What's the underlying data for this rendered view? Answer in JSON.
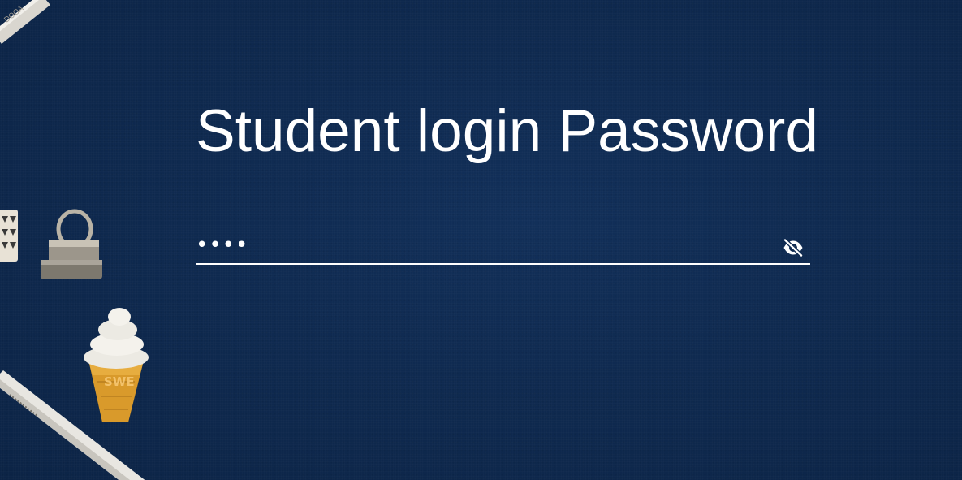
{
  "page": {
    "title": "Student login Password"
  },
  "password_field": {
    "value": "••••",
    "type": "password",
    "toggle_icon": "eye-off-icon"
  },
  "decorations": {
    "items": [
      "pencil-top",
      "binder-clip",
      "washi-tape",
      "ice-cream-eraser",
      "pencil-bottom"
    ],
    "eraser_text": "SWE"
  },
  "colors": {
    "background": "#0f2a50",
    "text": "#ffffff",
    "underline": "#ffffff"
  }
}
